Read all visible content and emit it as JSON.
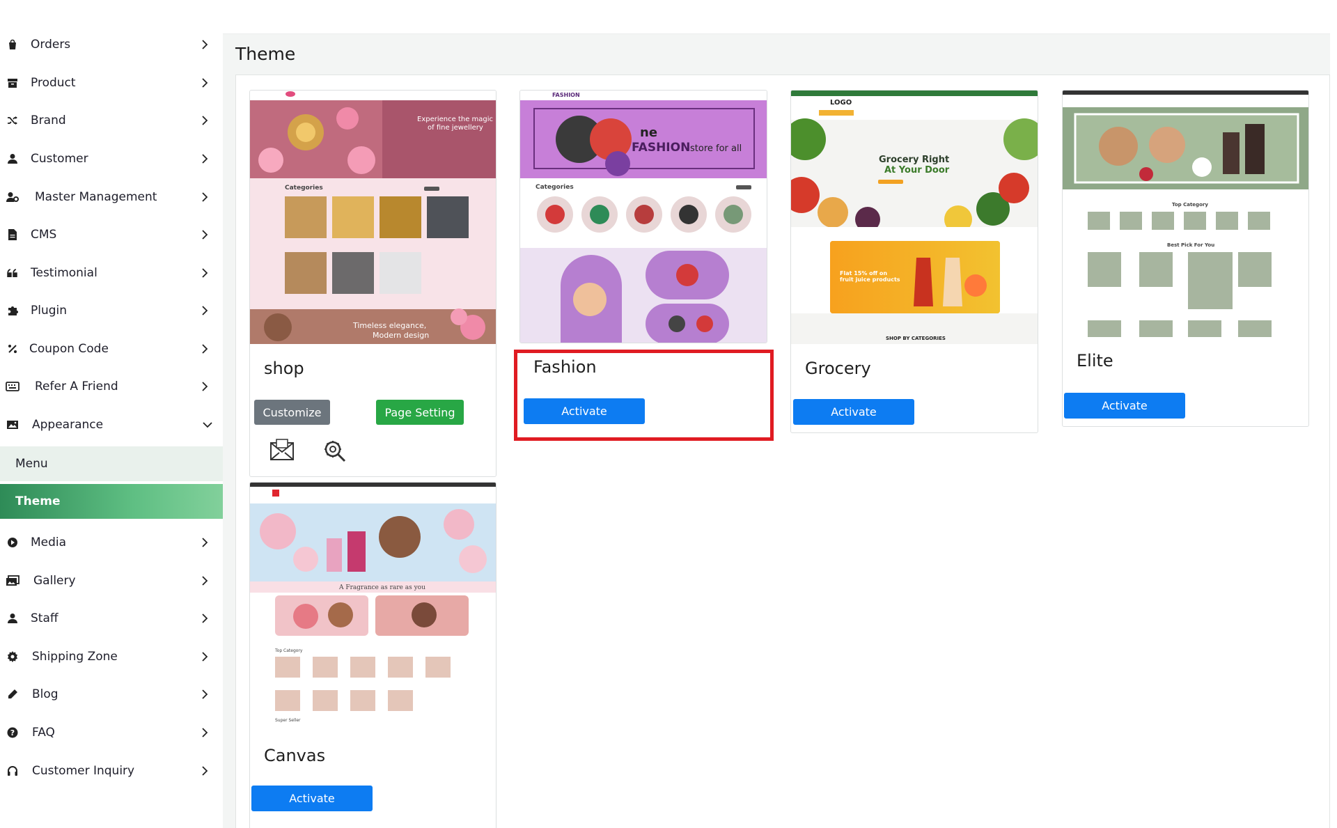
{
  "sidebar": {
    "items": [
      {
        "label": "Orders",
        "icon": "shopping-bag-icon"
      },
      {
        "label": "Product",
        "icon": "box-icon"
      },
      {
        "label": "Brand",
        "icon": "shuffle-icon"
      },
      {
        "label": "Customer",
        "icon": "user-icon"
      },
      {
        "label": "Master Management",
        "icon": "user-gear-icon"
      },
      {
        "label": "CMS",
        "icon": "file-icon"
      },
      {
        "label": "Testimonial",
        "icon": "quote-icon"
      },
      {
        "label": "Plugin",
        "icon": "puzzle-icon"
      },
      {
        "label": "Coupon Code",
        "icon": "percent-icon"
      },
      {
        "label": "Refer A Friend",
        "icon": "keyboard-icon"
      },
      {
        "label": "Appearance",
        "icon": "image-icon"
      }
    ],
    "sub_items": [
      {
        "label": "Menu"
      },
      {
        "label": "Theme"
      }
    ],
    "items_after": [
      {
        "label": "Media",
        "icon": "play-circle-icon"
      },
      {
        "label": "Gallery",
        "icon": "images-icon"
      },
      {
        "label": "Staff",
        "icon": "user-icon"
      },
      {
        "label": "Shipping Zone",
        "icon": "gear-icon"
      },
      {
        "label": "Blog",
        "icon": "pencil-icon"
      },
      {
        "label": "FAQ",
        "icon": "question-circle-icon"
      },
      {
        "label": "Customer Inquiry",
        "icon": "headphones-icon"
      }
    ]
  },
  "page": {
    "title": "Theme"
  },
  "themes": [
    {
      "name": "shop",
      "active": true,
      "customize_label": "Customize",
      "page_setting_label": "Page Setting",
      "thumb": {
        "hero_line1": "Experience the magic",
        "hero_line2": "of fine jewellery",
        "section": "Categories",
        "footer_line1": "Timeless elegance,",
        "footer_line2": "Modern design"
      }
    },
    {
      "name": "Fashion",
      "button": "Activate",
      "thumb": {
        "brand": "FASHION",
        "hero_a": "ne",
        "hero_b": "FASHION",
        "hero_c": "store for all",
        "section": "Categories"
      }
    },
    {
      "name": "Grocery",
      "button": "Activate",
      "thumb": {
        "logo": "LOGO",
        "hero_line1": "Grocery Right",
        "hero_line2": "At Your Door",
        "promo": "Flat 15% off on fruit juice products",
        "section": "SHOP BY CATEGORIES"
      }
    },
    {
      "name": "Elite",
      "button": "Activate",
      "thumb": {
        "section": "Top Category",
        "section2": "Best Pick For You"
      }
    },
    {
      "name": "Canvas",
      "button": "Activate",
      "thumb": {
        "tagline": "A Fragrance as rare as you",
        "section": "Top Category",
        "section2": "Super Seller"
      }
    }
  ],
  "colors": {
    "accent_green": "#28a745",
    "activate_blue": "#0d7cf2",
    "highlight_red": "#e01b22",
    "theme_active_bg": "#4caf78"
  }
}
